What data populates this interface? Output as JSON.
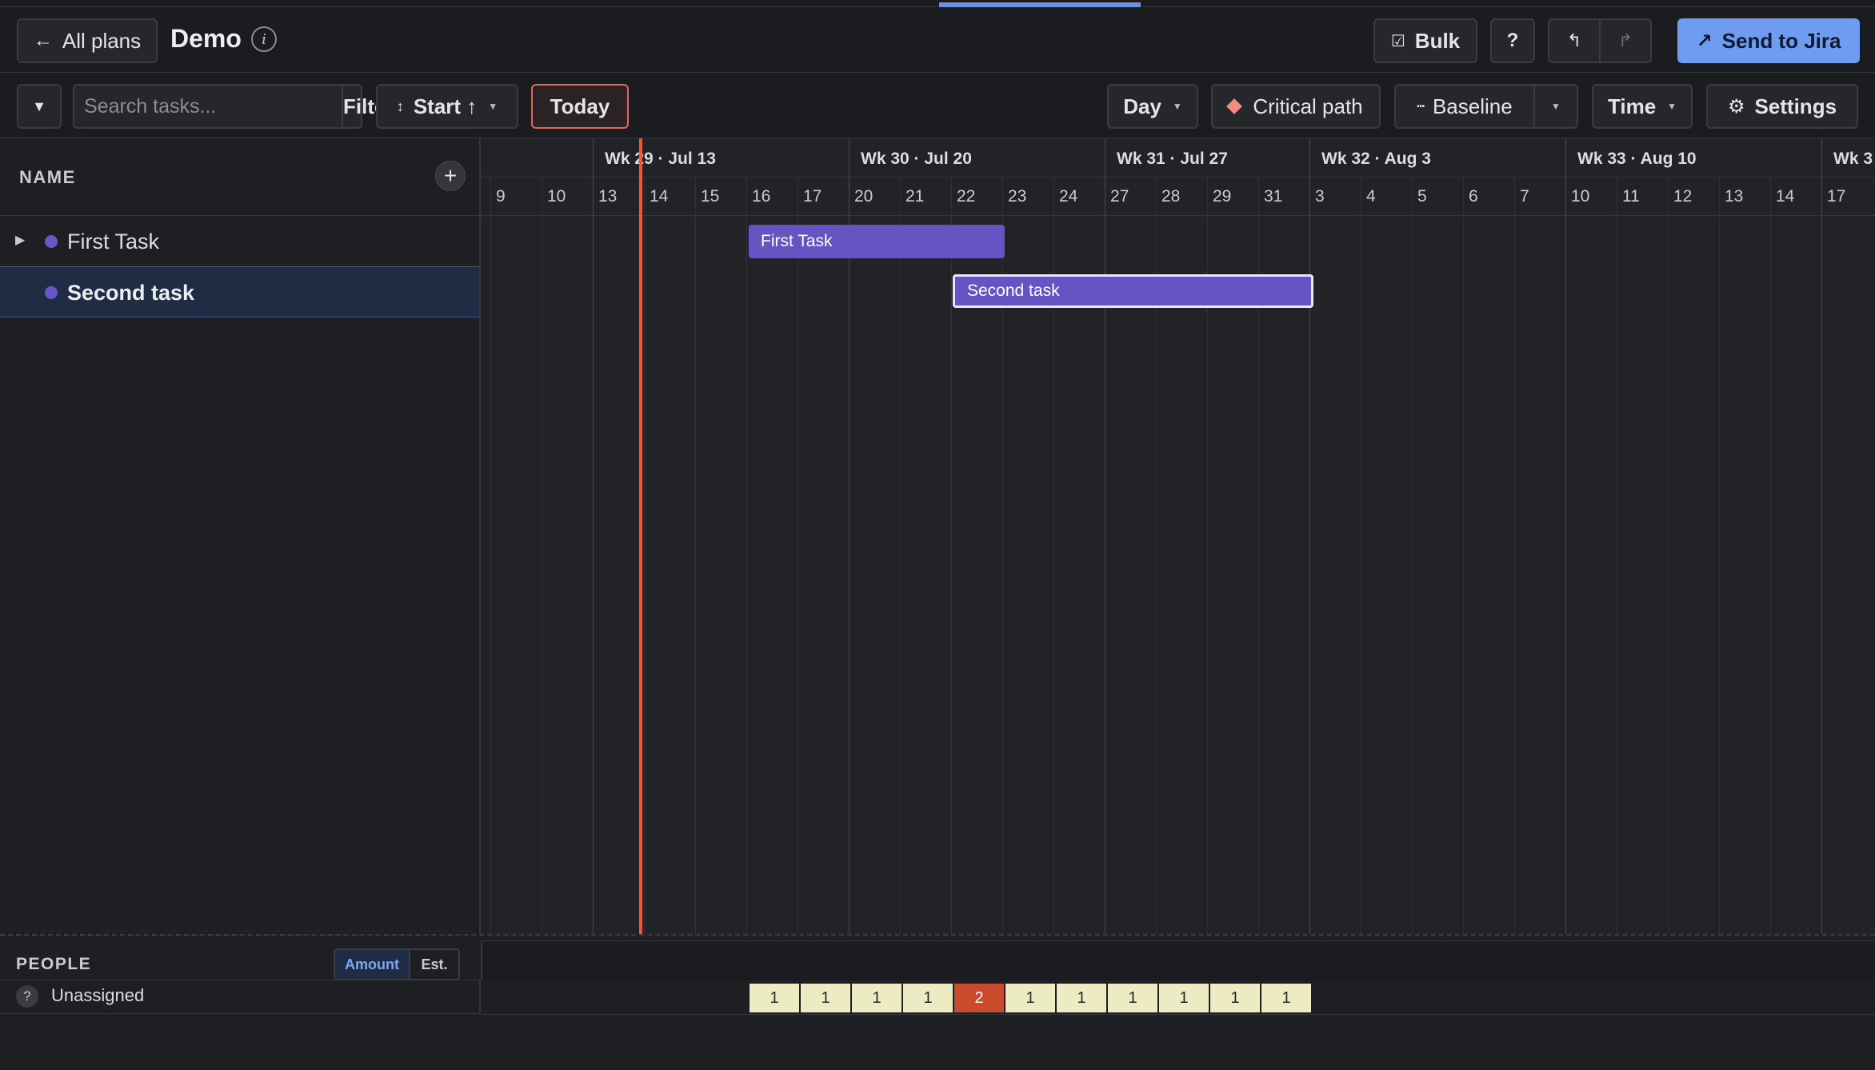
{
  "header": {
    "back_label": "All plans",
    "plan_title": "Demo",
    "info_glyph": "i",
    "bulk_label": "Bulk",
    "help_label": "?",
    "send_label": "Send to Jira"
  },
  "toolbar": {
    "search_placeholder": "Search tasks...",
    "filter_label": "Filter",
    "sort_label": "Start ↑",
    "today_label": "Today",
    "zoom_label": "Day",
    "critical_label": "Critical path",
    "baseline_label": "Baseline",
    "time_label": "Time",
    "settings_label": "Settings"
  },
  "tasks_panel": {
    "column_header": "NAME",
    "tasks": [
      {
        "name": "First Task",
        "expandable": true,
        "selected": false
      },
      {
        "name": "Second task",
        "expandable": false,
        "selected": true
      }
    ]
  },
  "timeline": {
    "weeks": [
      "Wk 29 · Jul 13",
      "Wk 30 · Jul 20",
      "Wk 31 · Jul 27",
      "Wk 32 · Aug 3",
      "Wk 33 · Aug 10",
      "Wk 3"
    ],
    "days": [
      "9",
      "10",
      "13",
      "14",
      "15",
      "16",
      "17",
      "20",
      "21",
      "22",
      "23",
      "24",
      "27",
      "28",
      "29",
      "31",
      "3",
      "4",
      "5",
      "6",
      "7",
      "10",
      "11",
      "12",
      "13",
      "14",
      "17"
    ],
    "bars": [
      {
        "label": "First Task",
        "start_day": "16",
        "end_day": "22"
      },
      {
        "label": "Second task",
        "start_day": "22",
        "end_day": "31"
      }
    ],
    "today_day": "13"
  },
  "people": {
    "section_label": "PEOPLE",
    "toggle_amount": "Amount",
    "toggle_est": "Est.",
    "unassigned_label": "Unassigned",
    "unassigned_glyph": "?",
    "load": [
      "1",
      "1",
      "1",
      "1",
      "2",
      "1",
      "1",
      "1",
      "1",
      "1",
      "1"
    ]
  },
  "colors": {
    "accent": "#6f9bf0",
    "task_bar": "#6654c3",
    "today_line": "#e35d3a",
    "overload": "#c94a2c",
    "load_cell": "#ecebc4"
  }
}
